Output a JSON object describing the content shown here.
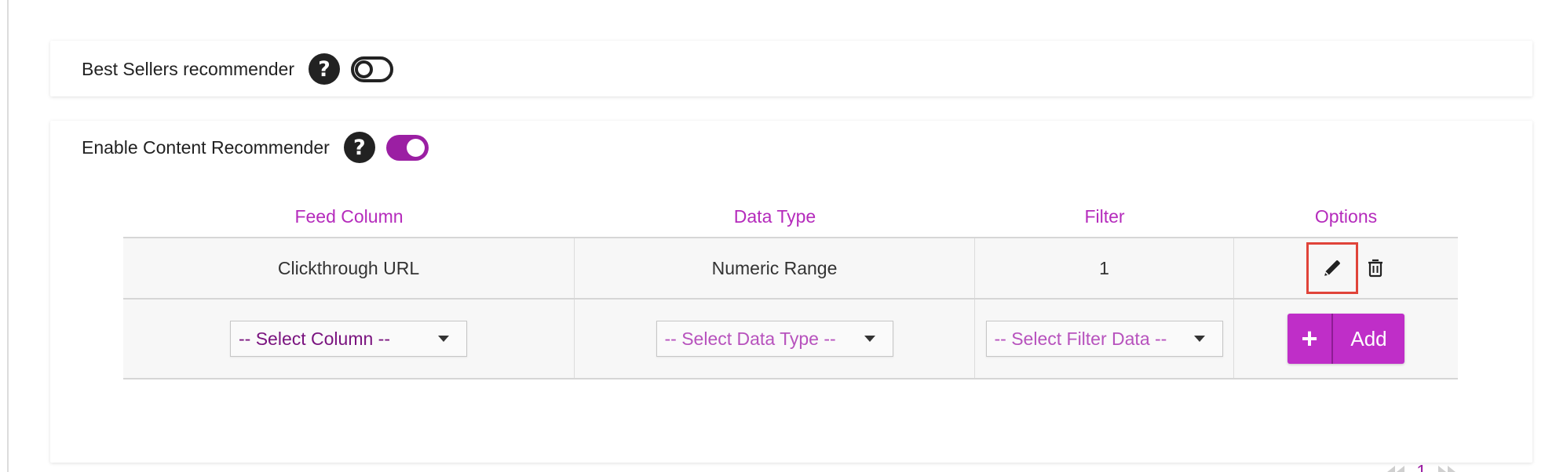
{
  "best_sellers": {
    "label": "Best Sellers recommender",
    "enabled": false
  },
  "content_recommender": {
    "label": "Enable Content Recommender",
    "enabled": true
  },
  "table": {
    "headers": [
      "Feed Column",
      "Data Type",
      "Filter",
      "Options"
    ],
    "rows": [
      {
        "feed_column": "Clickthrough URL",
        "data_type": "Numeric Range",
        "filter": "1"
      }
    ],
    "inputs": {
      "column_select": "-- Select Column --",
      "data_type_select": "-- Select Data Type --",
      "filter_select": "-- Select Filter Data --",
      "add_label": "Add"
    }
  },
  "pagination": {
    "current_page": "1"
  },
  "colors": {
    "accent": "#9b1fa3",
    "header_text": "#b52bbc",
    "add_button": "#bf2ec8",
    "highlight": "#e0443a"
  },
  "icons": [
    "help-icon",
    "toggle",
    "pencil-icon",
    "trash-icon",
    "plus-icon",
    "first-page-icon",
    "last-page-icon",
    "caret-down-icon"
  ]
}
